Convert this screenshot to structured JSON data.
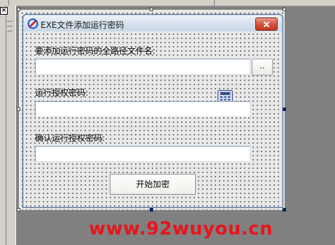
{
  "ide": {
    "panel_close_glyph": "×"
  },
  "dialog": {
    "title": "EXE文件添加运行密码",
    "icon": "app-logo-icon",
    "close_icon": "close-icon"
  },
  "form": {
    "file_label": "要添加运行密码的全路径文件名:",
    "file_value": "",
    "browse_label": "..",
    "password_label": "运行授权密码:",
    "password_value": "",
    "confirm_label": "确认运行授权密码:",
    "confirm_value": "",
    "start_button": "开始加密",
    "calc_icon": "calculator-icon"
  },
  "watermark": {
    "text": "www.92wuyou.cn"
  },
  "colors": {
    "accent": "#e8141b",
    "title_bar": "#d7e2ee",
    "close_button": "#c23a22"
  }
}
